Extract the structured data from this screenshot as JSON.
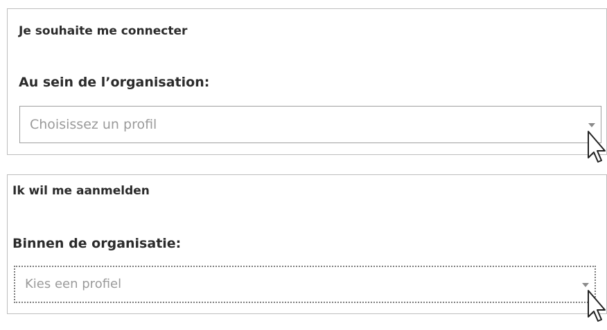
{
  "french_panel": {
    "heading": "Je souhaite me connecter",
    "field_label": "Au sein de l’organisation:",
    "select_placeholder": "Choisissez un profil"
  },
  "dutch_panel": {
    "heading": "Ik wil me aanmelden",
    "field_label": "Binnen de organisatie:",
    "select_placeholder": "Kies een profiel"
  },
  "icons": {
    "dropdown": "caret-down-icon",
    "pointer": "mouse-pointer-icon"
  }
}
